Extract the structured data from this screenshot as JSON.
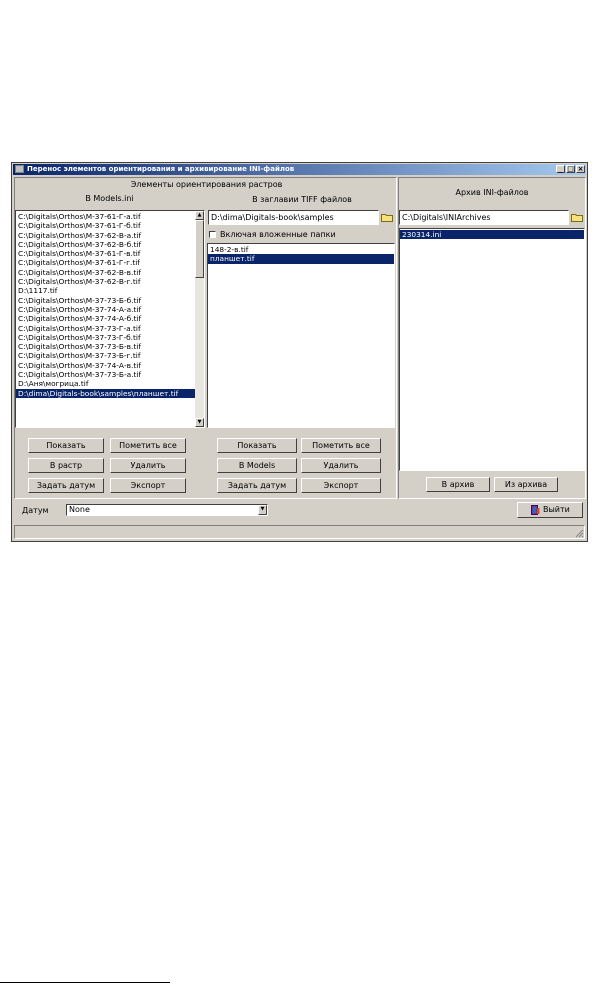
{
  "window": {
    "title": "Перенос элементов ориентирования и архивирование INI-файлов",
    "minimize_label": "_",
    "maximize_label": "□",
    "close_label": "×"
  },
  "left_group": {
    "title": "Элементы ориентирования растров",
    "models_panel": {
      "title": "В Models.ini",
      "items": [
        "C:\\Digitals\\Orthos\\M-37-61-Г-а.tif",
        "C:\\Digitals\\Orthos\\M-37-61-Г-б.tif",
        "C:\\Digitals\\Orthos\\M-37-62-В-а.tif",
        "C:\\Digitals\\Orthos\\M-37-62-В-б.tif",
        "C:\\Digitals\\Orthos\\M-37-61-Г-в.tif",
        "C:\\Digitals\\Orthos\\M-37-61-Г-г.tif",
        "C:\\Digitals\\Orthos\\M-37-62-В-в.tif",
        "C:\\Digitals\\Orthos\\M-37-62-В-г.tif",
        "D:\\1117.tif",
        "C:\\Digitals\\Orthos\\M-37-73-Б-б.tif",
        "C:\\Digitals\\Orthos\\M-37-74-А-а.tif",
        "C:\\Digitals\\Orthos\\M-37-74-А-б.tif",
        "C:\\Digitals\\Orthos\\M-37-73-Г-а.tif",
        "C:\\Digitals\\Orthos\\M-37-73-Г-б.tif",
        "C:\\Digitals\\Orthos\\M-37-73-Б-в.tif",
        "C:\\Digitals\\Orthos\\M-37-73-Б-г.tif",
        "C:\\Digitals\\Orthos\\M-37-74-А-в.tif",
        "C:\\Digitals\\Orthos\\M-37-73-Б-а.tif",
        "D:\\Аня\\могрица.tif",
        "D:\\dima\\Digitals-book\\samples\\планшет.tif"
      ],
      "selected_index": 19,
      "buttons": {
        "show": "Показать",
        "mark_all": "Пометить все",
        "to_raster": "В растр",
        "delete": "Удалить",
        "set_datum": "Задать датум",
        "export": "Экспорт"
      }
    },
    "tiff_panel": {
      "title": "В заглавии TIFF файлов",
      "path": "D:\\dima\\Digitals-book\\samples",
      "include_subfolders_label": "Включая вложенные папки",
      "include_subfolders_checked": false,
      "items": [
        "148-2-в.tif",
        "планшет.tif"
      ],
      "selected_index": 1,
      "buttons": {
        "show": "Показать",
        "mark_all": "Пометить все",
        "to_models": "В Models",
        "delete": "Удалить",
        "set_datum": "Задать датум",
        "export": "Экспорт"
      }
    }
  },
  "archive_group": {
    "title": "Архив INI-файлов",
    "path": "C:\\Digitals\\INIArchives",
    "items": [
      "230314.ini"
    ],
    "selected_index": 0,
    "buttons": {
      "to_archive": "В архив",
      "from_archive": "Из архива"
    }
  },
  "bottom": {
    "datum_label": "Датум",
    "datum_value": "None",
    "exit_label": "Выйти"
  },
  "icons": [
    "window-app-icon",
    "folder-icon",
    "exit-door-icon",
    "chevron-down-icon"
  ]
}
